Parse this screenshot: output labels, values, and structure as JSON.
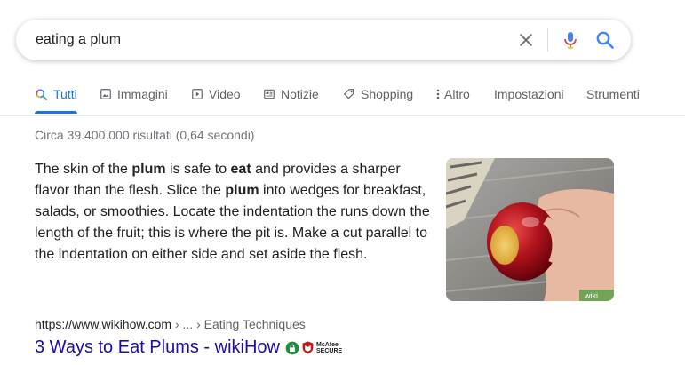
{
  "search": {
    "query": "eating a plum"
  },
  "tabs": [
    {
      "label": "Tutti",
      "icon": "search-icon",
      "active": true
    },
    {
      "label": "Immagini",
      "icon": "image-icon"
    },
    {
      "label": "Video",
      "icon": "video-icon"
    },
    {
      "label": "Notizie",
      "icon": "news-icon"
    },
    {
      "label": "Shopping",
      "icon": "tag-icon"
    },
    {
      "label": "Altro",
      "icon": "more-vert-icon"
    },
    {
      "label": "Impostazioni"
    },
    {
      "label": "Strumenti"
    }
  ],
  "stats": "Circa 39.400.000 risultati (0,64 secondi)",
  "snippet": {
    "parts": [
      {
        "t": "The skin of the ",
        "b": false
      },
      {
        "t": "plum",
        "b": true
      },
      {
        "t": " is safe to ",
        "b": false
      },
      {
        "t": "eat",
        "b": true
      },
      {
        "t": " and provides a sharper flavor than the flesh. Slice the ",
        "b": false
      },
      {
        "t": "plum",
        "b": true
      },
      {
        "t": " into wedges for breakfast, salads, or smoothies. Locate the indentation the runs down the length of the fruit; this is where the pit is. Make a cut parallel to the indentation on either side and set aside the flesh.",
        "b": false
      }
    ]
  },
  "thumbnail": {
    "watermark": "wiki"
  },
  "result": {
    "domain": "https://www.wikihow.com",
    "breadcrumb": " › ... › Eating Techniques",
    "title": "3 Ways to Eat Plums - wikiHow",
    "badge_top": "McAfee",
    "badge_bottom": "SECURE"
  },
  "colors": {
    "link": "#1a0dab",
    "accent": "#1a73e8",
    "secure_green": "#1e8e3e",
    "mcafee_red": "#c01818"
  }
}
